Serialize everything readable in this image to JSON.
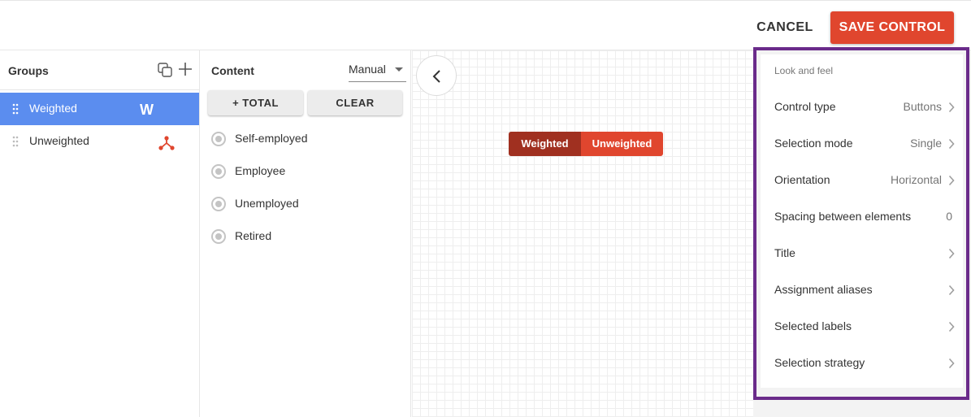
{
  "header": {
    "cancel_label": "CANCEL",
    "save_label": "SAVE CONTROL"
  },
  "groups": {
    "title": "Groups",
    "items": [
      {
        "label": "Weighted",
        "badge": "W"
      },
      {
        "label": "Unweighted",
        "icon": "tree-split-icon"
      }
    ]
  },
  "content": {
    "title": "Content",
    "mode": "Manual",
    "total_label": "+ TOTAL",
    "clear_label": "CLEAR",
    "options": [
      "Self-employed",
      "Employee",
      "Unemployed",
      "Retired"
    ]
  },
  "canvas": {
    "segments": [
      "Weighted",
      "Unweighted"
    ],
    "back_icon": "chevron-left-icon"
  },
  "properties": {
    "header": "Look and feel",
    "rows": [
      {
        "label": "Control type",
        "value": "Buttons"
      },
      {
        "label": "Selection mode",
        "value": "Single"
      },
      {
        "label": "Orientation",
        "value": "Horizontal"
      },
      {
        "label": "Spacing between elements",
        "value": "0"
      },
      {
        "label": "Title",
        "value": ""
      },
      {
        "label": "Assignment aliases",
        "value": ""
      },
      {
        "label": "Selected labels",
        "value": ""
      },
      {
        "label": "Selection strategy",
        "value": ""
      }
    ]
  },
  "colors": {
    "accent": "#e0462e",
    "accent_dark": "#a03020",
    "selection_blue": "#5b8def",
    "highlight_frame": "#6a2b8a"
  }
}
